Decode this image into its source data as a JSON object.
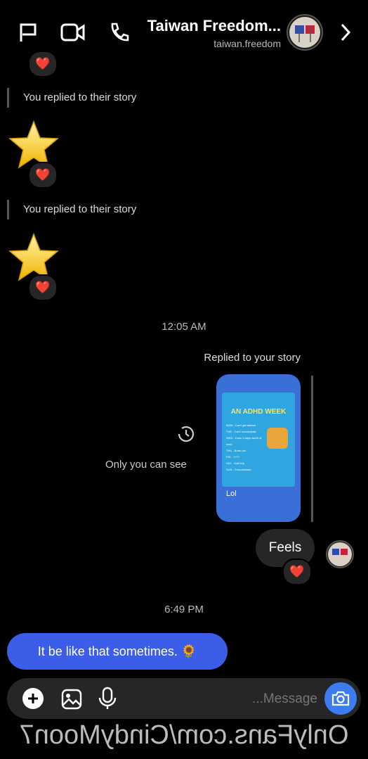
{
  "header": {
    "title": "Taiwan Freedom...",
    "subtitle": "taiwan.freedom"
  },
  "messages": {
    "replied_1": "You replied to their story",
    "replied_2": "You replied to their story",
    "time_1": "12:05 AM",
    "replied_your_story": "Replied to your story",
    "only_you": "Only you can see",
    "feels": "Feels",
    "time_2": "6:49 PM",
    "sent_msg": "It be like that sometimes. 🌻",
    "heart": "❤️"
  },
  "story": {
    "heading": "AN ADHD WEEK",
    "lines": [
      "MON - Can't get started",
      "TUE - Can't concentrate",
      "WED - Does 4 days worth of work",
      "THU - Burnt out",
      "FRI - ????",
      "SAT - Guilt trip",
      "SUN - Procrastinate"
    ],
    "caption": "Lol"
  },
  "composer": {
    "placeholder": "Message..."
  },
  "watermark": "OnlyFans.com/CindyMoon7"
}
